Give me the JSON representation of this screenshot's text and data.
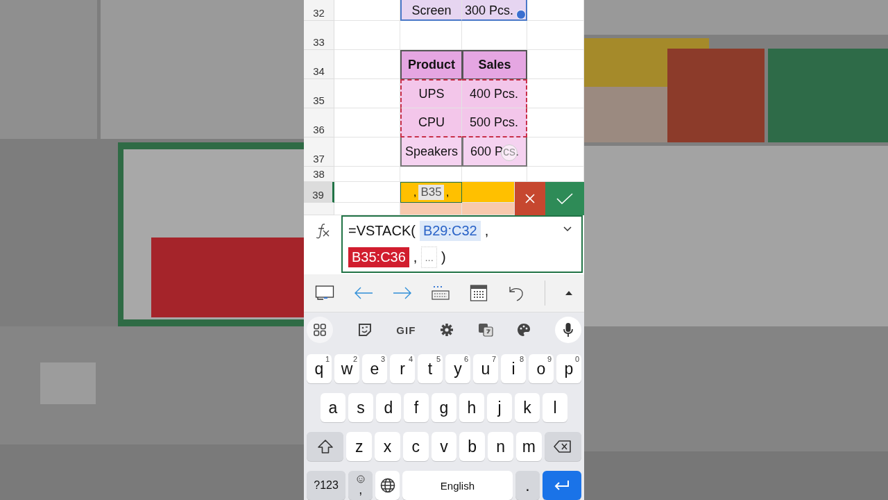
{
  "sheet": {
    "rows": [
      {
        "number": "32",
        "kind": "range",
        "selected": false,
        "cells": [
          {
            "text": "Screen"
          },
          {
            "text": "300 Pcs."
          }
        ]
      },
      {
        "number": "33",
        "kind": "blank",
        "selected": false,
        "cells": []
      },
      {
        "number": "34",
        "kind": "header",
        "selected": false,
        "cells": [
          {
            "text": "Product"
          },
          {
            "text": "Sales"
          }
        ]
      },
      {
        "number": "35",
        "kind": "marked",
        "selected": false,
        "cells": [
          {
            "text": "UPS"
          },
          {
            "text": "400 Pcs."
          }
        ]
      },
      {
        "number": "36",
        "kind": "marked",
        "selected": false,
        "cells": [
          {
            "text": "CPU"
          },
          {
            "text": "500 Pcs."
          }
        ]
      },
      {
        "number": "37",
        "kind": "table",
        "selected": false,
        "cells": [
          {
            "text": "Speakers"
          },
          {
            "text": "600 Pcs."
          }
        ]
      },
      {
        "number": "38",
        "kind": "blank",
        "selected": false,
        "cells": []
      },
      {
        "number": "39",
        "kind": "editing",
        "selected": true,
        "cells": [
          {
            "parts": [
              {
                "text": ",",
                "kind": "plain"
              },
              {
                "text": "B35",
                "kind": "chip"
              },
              {
                "text": ",",
                "kind": "plain"
              }
            ]
          }
        ]
      },
      {
        "kind": "peach",
        "selected": false,
        "cells": []
      }
    ]
  },
  "formula": {
    "lines": [
      [
        {
          "text": "=VSTACK(",
          "kind": "plain"
        },
        {
          "text": "B29:C32",
          "kind": "ref-blue"
        },
        {
          "text": ",",
          "kind": "plain"
        }
      ],
      [
        {
          "text": "B35:C36",
          "kind": "ref-red"
        },
        {
          "text": ",",
          "kind": "plain"
        },
        {
          "text": "...",
          "kind": "hint"
        },
        {
          "text": ")",
          "kind": "plain"
        }
      ]
    ]
  },
  "keyboard": {
    "gif_label": "GIF",
    "rows": [
      {
        "keys": [
          {
            "kind": "letter",
            "label": "q",
            "hint": "1"
          },
          {
            "kind": "letter",
            "label": "w",
            "hint": "2"
          },
          {
            "kind": "letter",
            "label": "e",
            "hint": "3"
          },
          {
            "kind": "letter",
            "label": "r",
            "hint": "4"
          },
          {
            "kind": "letter",
            "label": "t",
            "hint": "5"
          },
          {
            "kind": "letter",
            "label": "y",
            "hint": "6"
          },
          {
            "kind": "letter",
            "label": "u",
            "hint": "7"
          },
          {
            "kind": "letter",
            "label": "i",
            "hint": "8"
          },
          {
            "kind": "letter",
            "label": "o",
            "hint": "9"
          },
          {
            "kind": "letter",
            "label": "p",
            "hint": "0"
          }
        ]
      },
      {
        "keys": [
          {
            "kind": "letter",
            "label": "a"
          },
          {
            "kind": "letter",
            "label": "s"
          },
          {
            "kind": "letter",
            "label": "d"
          },
          {
            "kind": "letter",
            "label": "f"
          },
          {
            "kind": "letter",
            "label": "g"
          },
          {
            "kind": "letter",
            "label": "h"
          },
          {
            "kind": "letter",
            "label": "j"
          },
          {
            "kind": "letter",
            "label": "k"
          },
          {
            "kind": "letter",
            "label": "l"
          }
        ]
      },
      {
        "keys": [
          {
            "kind": "shift"
          },
          {
            "kind": "letter",
            "label": "z"
          },
          {
            "kind": "letter",
            "label": "x"
          },
          {
            "kind": "letter",
            "label": "c"
          },
          {
            "kind": "letter",
            "label": "v"
          },
          {
            "kind": "letter",
            "label": "b"
          },
          {
            "kind": "letter",
            "label": "n"
          },
          {
            "kind": "letter",
            "label": "m"
          },
          {
            "kind": "backspace"
          }
        ]
      },
      {
        "keys": [
          {
            "kind": "symbols",
            "label": "?123"
          },
          {
            "kind": "emoji",
            "label": ","
          },
          {
            "kind": "globe"
          },
          {
            "kind": "space",
            "label": "English"
          },
          {
            "kind": "period",
            "label": "."
          },
          {
            "kind": "enter"
          }
        ]
      }
    ]
  }
}
